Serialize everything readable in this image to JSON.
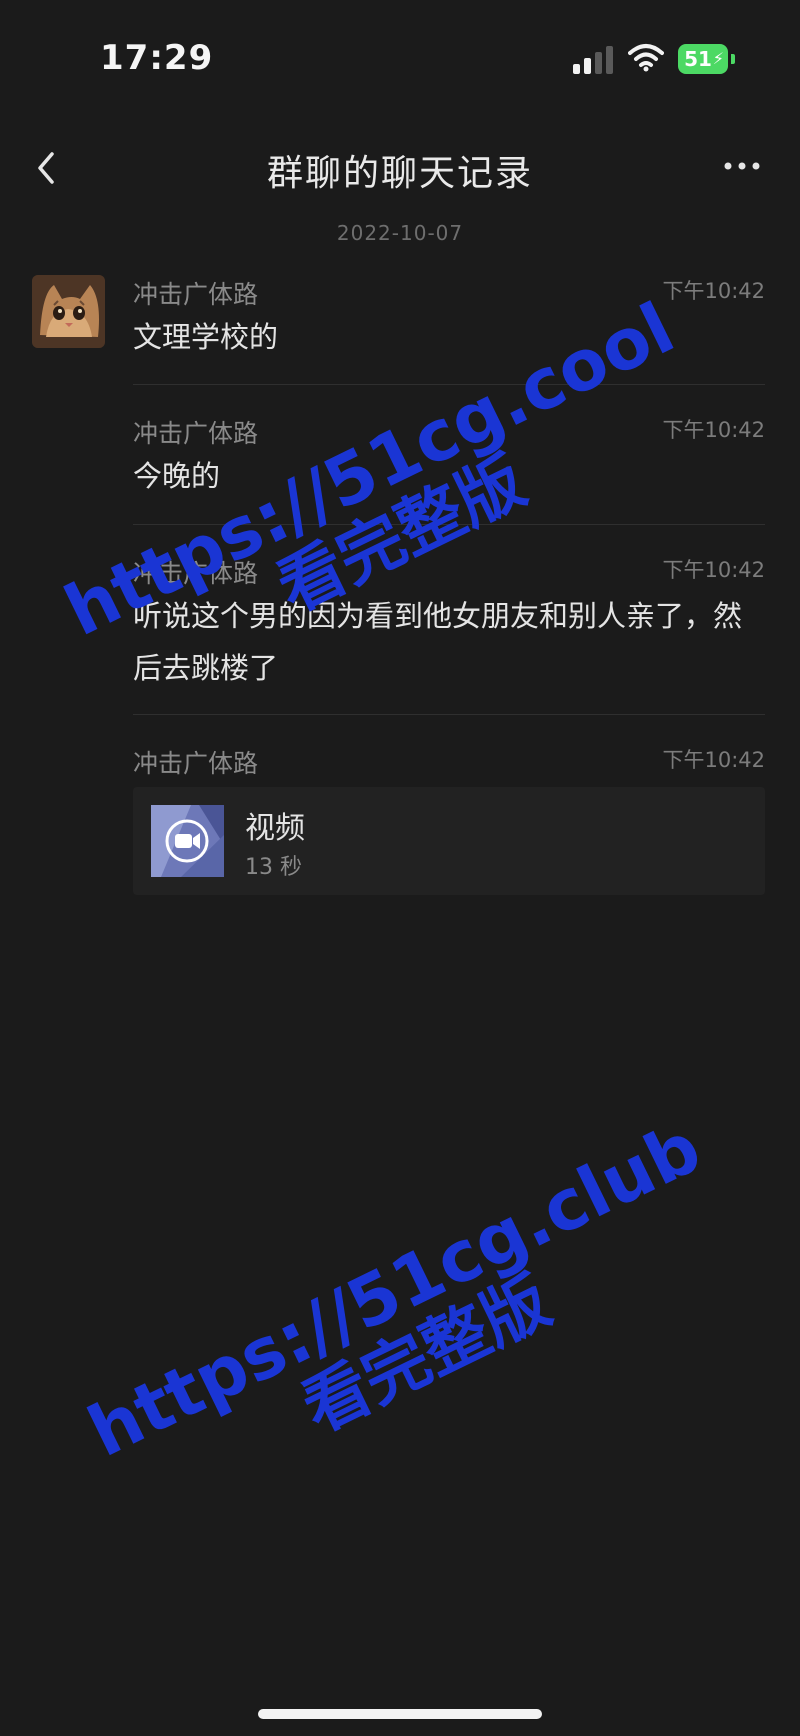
{
  "status_bar": {
    "time": "17:29",
    "battery": "51",
    "battery_color": "#4cd964"
  },
  "nav": {
    "title": "群聊的聊天记录",
    "back_icon": "chevron-left-icon",
    "more_icon": "ellipsis-icon"
  },
  "date": "2022-10-07",
  "messages": [
    {
      "sender": "冲击广体路",
      "time": "下午10:42",
      "text": "文理学校的"
    },
    {
      "sender": "冲击广体路",
      "time": "下午10:42",
      "text": "今晚的"
    },
    {
      "sender": "冲击广体路",
      "time": "下午10:42",
      "text": "听说这个男的因为看到他女朋友和别人亲了，然后去跳楼了"
    },
    {
      "sender": "冲击广体路",
      "time": "下午10:42",
      "video": {
        "title": "视频",
        "duration": "13 秒"
      }
    }
  ],
  "watermarks": [
    {
      "url": "https://51cg.cool",
      "text": "看完整版"
    },
    {
      "url": "https://51cg.club",
      "text": "看完整版"
    }
  ],
  "colors": {
    "background": "#1b1b1b",
    "watermark": "#1a35d4"
  }
}
